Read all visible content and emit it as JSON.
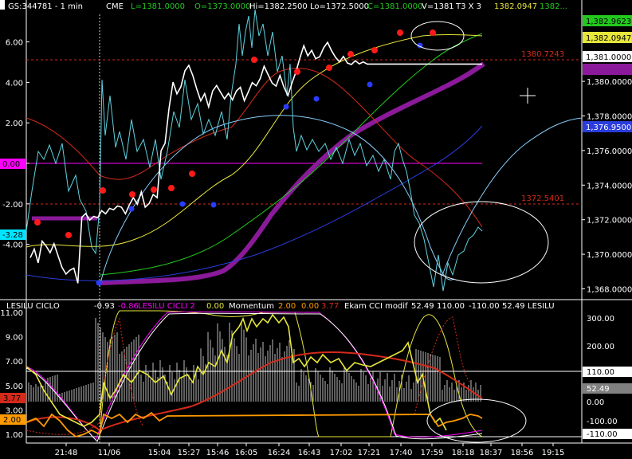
{
  "header": {
    "symbol": "GS:344781 - 1 min",
    "exchange": "CME",
    "last": "L=1381.0000",
    "open": "O=1373.0000",
    "high": "Hi=1382.2500",
    "low": "Lo=1372.5000",
    "close": "C=1381.0000",
    "volume": "V=1381",
    "ticks": "T3 X 3",
    "v1": "1382.0947",
    "v2": "1382..."
  },
  "lower_header": {
    "i1": "LESILU CICLO",
    "i1v": "-0.93",
    "i2": "LESILU CICLI 2",
    "i2v": "0.00",
    "i3": "Momentum",
    "i3v1": "2.00",
    "i3v2": "0.00",
    "i3v3": "3.77",
    "i4": "Ekam CCI modif",
    "i4v1": "52.49",
    "i4v2": "110.00",
    "i4v3": "-110.00",
    "i4v4": "52.49",
    "i5": "LESILU"
  },
  "i2v_neg": "-0.86",
  "price_labels": {
    "upper_line": "1380.7243",
    "lower_line": "1372.5401",
    "tag_green": "1,382.9623",
    "tag_yellow": "1,382.0947",
    "tag_white": "1,381.0000",
    "tag_blue": "1,376.9500",
    "tag_hidden": "1,380.000"
  },
  "left_tags": {
    "magenta": "0.00",
    "cyan": "-3.28",
    "red": "3.77",
    "orange": "2.00"
  },
  "right_tags": {
    "t110": "110.00",
    "t52": "52.49",
    "tneg110": "-110.00",
    "tneg_hidden": "-100.00"
  },
  "colors": {
    "background": "#000000",
    "price": "#ffffff",
    "cyan": "#5fd3e0",
    "purple": "#8b1a9a",
    "red": "#d42a1a",
    "yellow": "#e6e63c",
    "green": "#23c81e",
    "blue": "#2a3cdc",
    "orange": "#ff9a00",
    "magenta": "#ff00ff"
  },
  "chart_data": [
    {
      "type": "line",
      "left_axis": {
        "ticks": [
          6.0,
          4.0,
          2.0,
          0.0,
          -2.0,
          -4.0
        ],
        "tick_labels": [
          "6.00",
          "4.00",
          "2.00",
          "0.00",
          "-2.00",
          "-4.00"
        ]
      },
      "right_axis": {
        "ticks": [
          1380,
          1378,
          1376,
          1374,
          1372,
          1370,
          1368
        ],
        "tick_labels": [
          "1,380.0000",
          "1,378.0000",
          "1,376.0000",
          "1,374.0000",
          "1,372.0000",
          "1,370.0000",
          "1,368.0000"
        ]
      },
      "ylim": [
        1366.8,
        1383.7
      ],
      "x": [
        0,
        5,
        10,
        15,
        20,
        25,
        30,
        35,
        40,
        45,
        50,
        55,
        60,
        65,
        70,
        75,
        80,
        85,
        90,
        95,
        100,
        105,
        110,
        115,
        120,
        125,
        130,
        135,
        140,
        145,
        150,
        155,
        160,
        165,
        170,
        175,
        180,
        185,
        190,
        195,
        200,
        205,
        210,
        215,
        220,
        225,
        230,
        235,
        240,
        245,
        250,
        255,
        260,
        265,
        270,
        275,
        280,
        285,
        290,
        295,
        300,
        305,
        310,
        315,
        320,
        325,
        330,
        335,
        340,
        345,
        350,
        355,
        360,
        365,
        370,
        375,
        380,
        385,
        390,
        395,
        400,
        405,
        410,
        415,
        420,
        425,
        430,
        435,
        440,
        445,
        450,
        455,
        460,
        465,
        470,
        475,
        480,
        485,
        490,
        495,
        500,
        505,
        510,
        515,
        520,
        525,
        530,
        535,
        540,
        545,
        550,
        555,
        560,
        565,
        570
      ],
      "series": [
        {
          "values": [
            1369.8,
            1370.3,
            1369.5,
            1370.8,
            1370.5,
            1370.1,
            1370.6,
            1369.9,
            1369.2,
            1368.8,
            1369.0,
            1369.1,
            1368.4,
            1372.2,
            1372.4,
            1372.0,
            1372.2,
            1372.1,
            1372.5,
            1372.3,
            1372.6,
            1372.5,
            1372.7,
            1372.8,
            1372.4,
            1372.9,
            1373.3,
            1372.9,
            1373.6,
            1372.7,
            1372.9,
            1373.4,
            1373.2,
            1375.9,
            1376.5,
            1378.5,
            1380.0,
            1379.3,
            1379.7,
            1380.6,
            1380.9,
            1380.3,
            1379.5,
            1378.8,
            1379.2,
            1378.6,
            1379.5,
            1379.8,
            1379.4,
            1379.0,
            1379.3,
            1378.9,
            1379.4,
            1379.6,
            1378.8,
            1379.3,
            1380.0,
            1379.8,
            1380.2,
            1380.9,
            1380.4,
            1379.9,
            1379.7,
            1380.3,
            1379.6,
            1379.1,
            1379.8,
            1380.6,
            1381.4,
            1382.1,
            1381.5,
            1381.8,
            1381.3,
            1381.4,
            1381.9,
            1382.2,
            1381.7,
            1381.3,
            1381.2,
            1381.5,
            1381.1,
            1381.0,
            1381.2,
            1381.0,
            1381.1,
            1381.0,
            1381.0,
            1381.0,
            1381.0,
            1381.0,
            1381.0,
            1381.0,
            1381.0,
            1381.0,
            1381.0,
            1381.0,
            1381.0,
            1381.0,
            1381.0,
            1381.0,
            1381.0,
            1381.0,
            1381.0,
            1381.0,
            1381.0,
            1381.0,
            1381.0,
            1381.0,
            1381.0,
            1381.0,
            1381.0,
            1381.0,
            1381.0,
            1381.0,
            1381.0
          ]
        }
      ],
      "x_tick_labels": [
        "21:48",
        "11/06",
        "15:04",
        "15:27",
        "15:46",
        "16:05",
        "16:24",
        "16:43",
        "17:02",
        "17:21",
        "17:40",
        "17:59",
        "18:18",
        "18:37",
        "18:56",
        "19:15"
      ]
    },
    {
      "type": "line",
      "left_axis": {
        "ticks": [
          11.0,
          9.0,
          7.0,
          5.0,
          3.0,
          1.0
        ],
        "tick_labels": [
          "11.00",
          "9.00",
          "7.00",
          "5.00",
          "3.00",
          "1.00"
        ]
      },
      "right_axis": {
        "ticks": [
          300,
          200,
          100,
          0
        ],
        "tick_labels": [
          "300.00",
          "200.00",
          "100.00",
          "0.00"
        ]
      },
      "ylim": [
        0,
        12
      ]
    }
  ]
}
